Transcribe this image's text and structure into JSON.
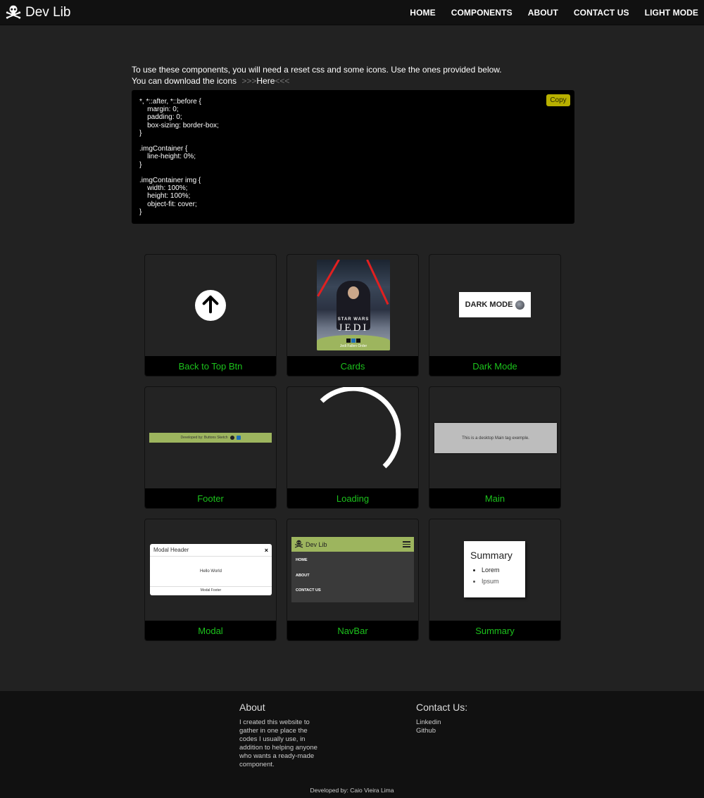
{
  "header": {
    "brand": "Dev Lib",
    "nav": [
      "HOME",
      "COMPONENTS",
      "ABOUT",
      "CONTACT US",
      "LIGHT MODE"
    ]
  },
  "intro": {
    "line1": "To use these components, you will need a reset css and some icons. Use the ones provided below.",
    "line2": "You can download the icons",
    "link_prefix": ">>>",
    "link_text": "Here",
    "link_suffix": "<<<"
  },
  "code_block": {
    "copy_label": "Copy",
    "code": "*, *::after, *::before {\n    margin: 0;\n    padding: 0;\n    box-sizing: border-box;\n}\n\n.imgContainer {\n    line-height: 0%;\n}\n\n.imgContainer img {\n    width: 100%;\n    height: 100%;\n    object-fit: cover;\n}"
  },
  "cards": [
    {
      "label": "Back to Top Btn"
    },
    {
      "label": "Cards",
      "poster_title": "STAR WARS",
      "poster_subtitle": "JEDI",
      "poster_caption": "Jedi Fallen Order"
    },
    {
      "label": "Dark Mode",
      "button_text": "DARK MODE"
    },
    {
      "label": "Footer",
      "footer_text": "Developed by: Buttons Sketch"
    },
    {
      "label": "Loading"
    },
    {
      "label": "Main",
      "main_text": "This is a desktop Main tag exemple."
    },
    {
      "label": "Modal",
      "modal_header": "Modal Header",
      "modal_close": "×",
      "modal_body": "Hello World",
      "modal_footer": "Modal Footer"
    },
    {
      "label": "NavBar",
      "nav_brand": "Dev Lib",
      "nav_items": [
        "HOME",
        "ABOUT",
        "CONTACT US"
      ]
    },
    {
      "label": "Summary",
      "summary_title": "Summary",
      "summary_items": [
        "Lorem",
        "Ipsum"
      ]
    }
  ],
  "footer": {
    "about_title": "About",
    "about_text": "I created this website to gather in one place the codes I usually use, in addition to helping anyone who wants a ready-made component.",
    "contact_title": "Contact Us:",
    "contact_links": [
      "Linkedin",
      "Github"
    ],
    "credit": "Developed by: Caio Vieira Lima"
  },
  "colors": {
    "accent_green": "#1cc21c",
    "copy_button": "#b8b000",
    "thumb_green": "#9db55e"
  }
}
